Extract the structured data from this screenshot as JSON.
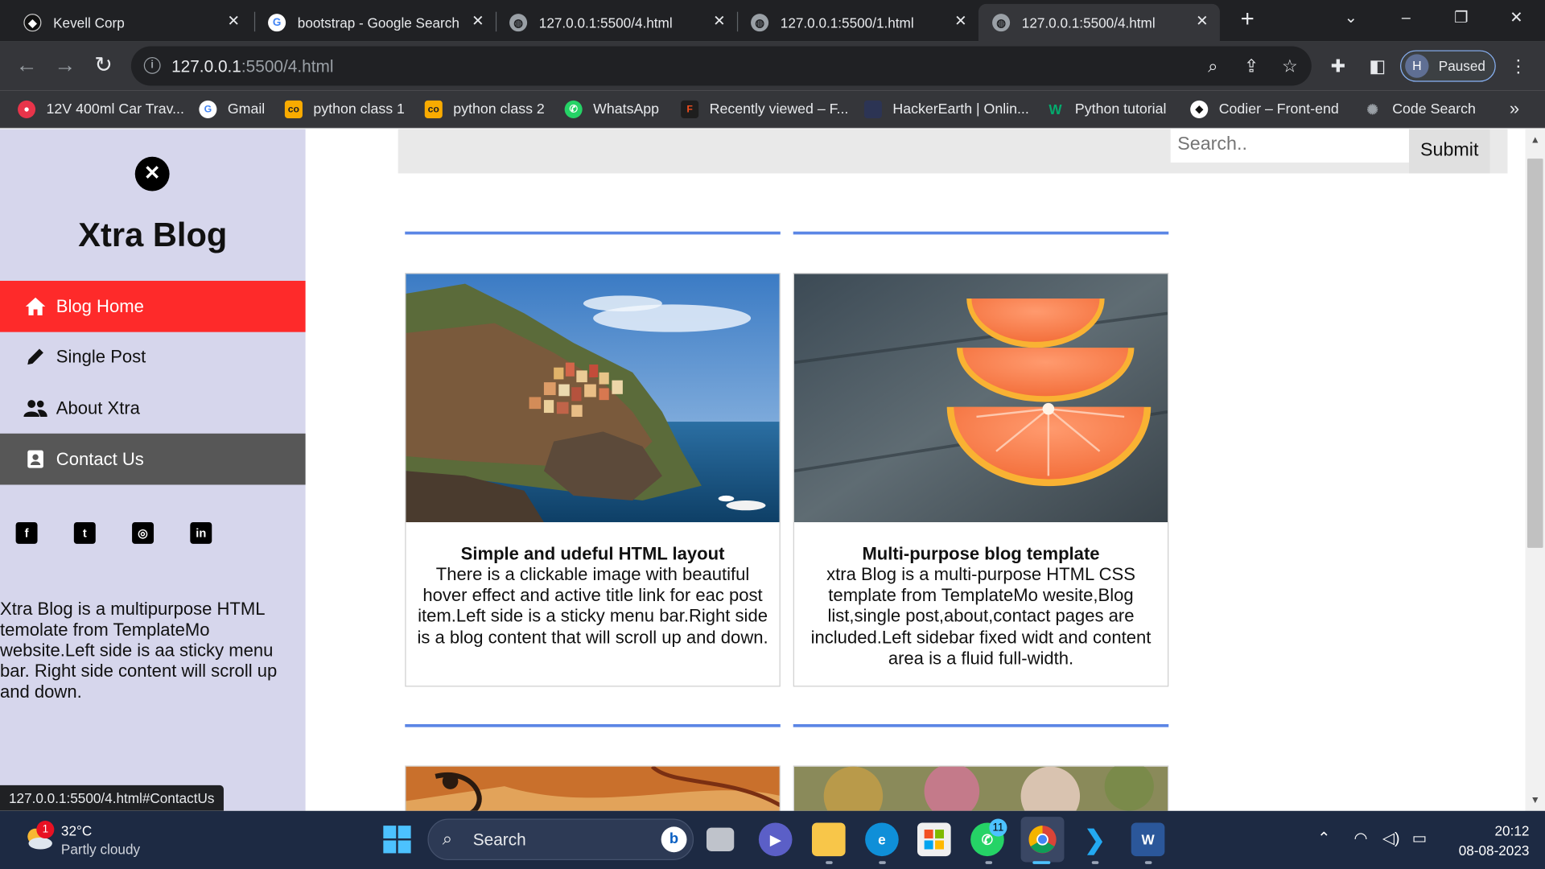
{
  "browser": {
    "tabs": [
      {
        "title": "Kevell Corp",
        "active": false
      },
      {
        "title": "bootstrap - Google Search",
        "active": false
      },
      {
        "title": "127.0.0.1:5500/4.html",
        "active": false
      },
      {
        "title": "127.0.0.1:5500/1.html",
        "active": false
      },
      {
        "title": "127.0.0.1:5500/4.html",
        "active": true
      }
    ],
    "address": {
      "host": "127.0.0.1",
      "path": ":5500/4.html"
    },
    "profile_initial": "H",
    "profile_label": "Paused",
    "bookmarks": [
      {
        "label": "12V 400ml Car Trav...",
        "icon": "red-circle-icon",
        "color": "#e8344a"
      },
      {
        "label": "Gmail",
        "icon": "google-icon",
        "color": "#ffffff"
      },
      {
        "label": "python class 1",
        "icon": "colab-icon",
        "color": "#f9ab00"
      },
      {
        "label": "python class 2",
        "icon": "colab-icon",
        "color": "#f9ab00"
      },
      {
        "label": "WhatsApp",
        "icon": "whatsapp-icon",
        "color": "#25d366"
      },
      {
        "label": "Recently viewed – F...",
        "icon": "figma-icon",
        "color": "#a259ff"
      },
      {
        "label": "HackerEarth | Onlin...",
        "icon": "hackerearth-icon",
        "color": "#2c3454"
      },
      {
        "label": "Python tutorial",
        "icon": "w3-icon",
        "color": "#04aa6d"
      },
      {
        "label": "Codier – Front-end",
        "icon": "codier-icon",
        "color": "#111111"
      },
      {
        "label": "Code Search",
        "icon": "code-search-icon",
        "color": "#8a8a8a"
      }
    ]
  },
  "sidebar": {
    "brand": "Xtra Blog",
    "menu": [
      {
        "label": "Blog Home",
        "icon": "home-icon",
        "state": "active"
      },
      {
        "label": "Single Post",
        "icon": "pencil-icon",
        "state": "normal"
      },
      {
        "label": "About Xtra",
        "icon": "users-icon",
        "state": "normal"
      },
      {
        "label": "Contact Us",
        "icon": "contact-card-icon",
        "state": "hover"
      }
    ],
    "social": [
      "facebook-icon",
      "twitter-icon",
      "instagram-icon",
      "linkedin-icon"
    ],
    "description": "Xtra Blog is a multipurpose HTML temolate from TemplateMo website.Left side is aa sticky menu bar. Right side content will scroll up and down."
  },
  "search": {
    "placeholder": "Search..",
    "button": "Submit"
  },
  "posts": [
    {
      "title": "Simple and udeful HTML layout",
      "text": "There is a clickable image with beautiful hover effect and active title link for eac post item.Left side is a sticky menu bar.Right side is a blog content that will scroll up and down.",
      "image": "coastal-village-photo"
    },
    {
      "title": "Multi-purpose blog template",
      "text": "xtra Blog is a multi-purpose HTML CSS template from TemplateMo wesite,Blog list,single post,about,contact pages are included.Left sidebar fixed widt and content area is a fluid full-width.",
      "image": "orange-slices-photo"
    }
  ],
  "status_url": "127.0.0.1:5500/4.html#ContactUs",
  "colors": {
    "accent_line": "#5b86e5",
    "active_menu": "#fe2a2a",
    "hover_menu": "#575757",
    "sidebar_bg": "#d6d6ec"
  },
  "taskbar": {
    "weather_temp": "32°C",
    "weather_desc": "Partly cloudy",
    "weather_badge": "1",
    "search_label": "Search",
    "whatsapp_badge": "11",
    "time": "20:12",
    "date": "08-08-2023"
  }
}
